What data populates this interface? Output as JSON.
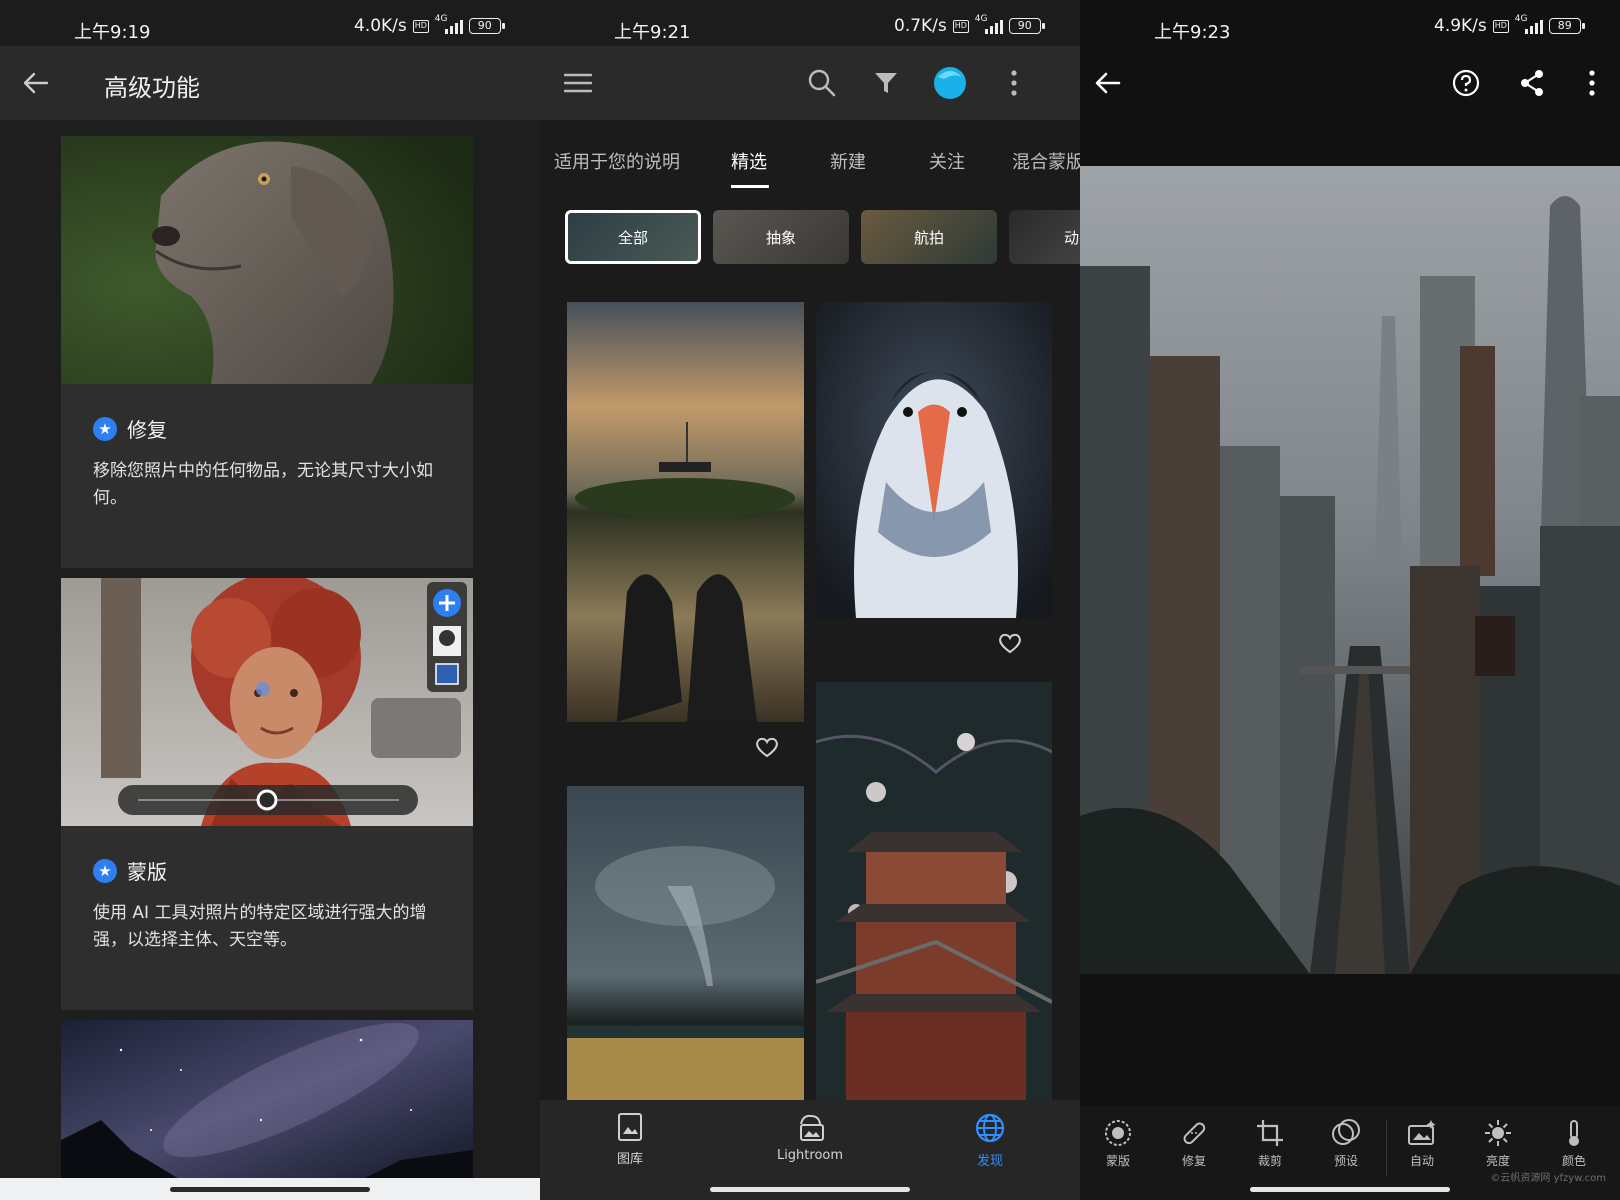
{
  "colors": {
    "accent_blue": "#2e7ff0",
    "discover_blue": "#2f8fff",
    "avatar_cyan": "#1ab0e8"
  },
  "panel1": {
    "status": {
      "time": "上午9:19",
      "speed": "4.0K/s",
      "signal": "4G",
      "battery": "90"
    },
    "title": "高级功能",
    "cards": [
      {
        "title": "修复",
        "desc": "移除您照片中的任何物品，无论其尺寸大小如何。"
      },
      {
        "title": "蒙版",
        "desc": "使用 AI 工具对照片的特定区域进行强大的增强，以选择主体、天空等。"
      }
    ]
  },
  "panel2": {
    "status": {
      "time": "上午9:21",
      "speed": "0.7K/s",
      "signal": "4G",
      "battery": "90"
    },
    "tabs": [
      "适用于您的说明",
      "精选",
      "新建",
      "关注",
      "混合蒙版"
    ],
    "active_tab": "精选",
    "chips": [
      "全部",
      "抽象",
      "航拍",
      "动"
    ],
    "bottom_nav": [
      "图库",
      "Lightroom",
      "发现"
    ]
  },
  "panel3": {
    "status": {
      "time": "上午9:23",
      "speed": "4.9K/s",
      "signal": "4G",
      "battery": "89"
    },
    "tools": [
      "蒙版",
      "修复",
      "裁剪",
      "预设",
      "自动",
      "亮度",
      "颜色"
    ],
    "watermark": "©云帆资源网 yfzyw.com"
  }
}
